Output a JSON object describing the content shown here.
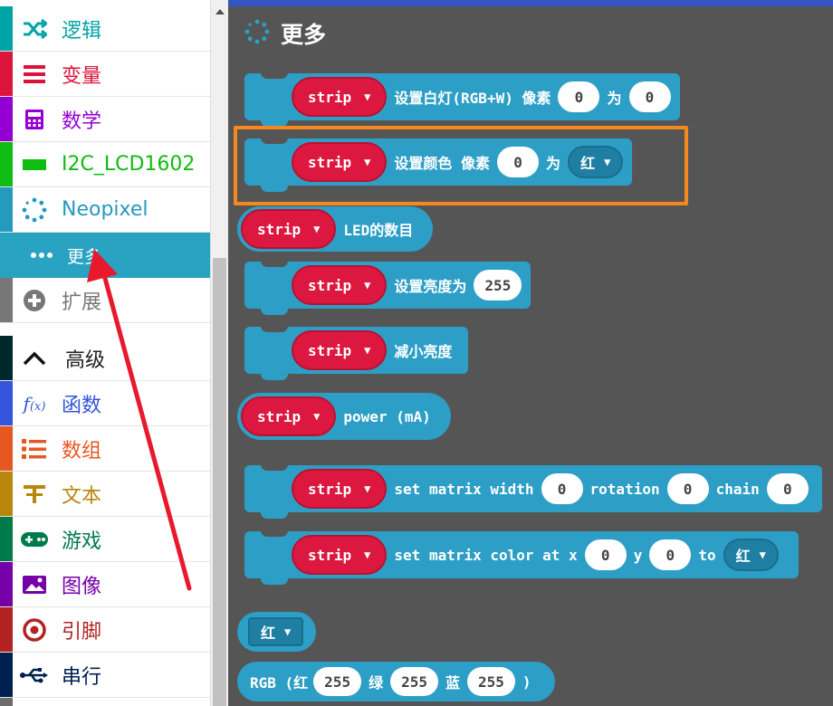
{
  "sidebar": {
    "items": [
      {
        "label": "逻辑",
        "icon": "shuffle-icon",
        "color": "#00a4a6"
      },
      {
        "label": "变量",
        "icon": "list-lines-icon",
        "color": "#dc143c"
      },
      {
        "label": "数学",
        "icon": "calculator-icon",
        "color": "#9400d3"
      },
      {
        "label": "I2C_LCD1602",
        "icon": "rectangle-icon",
        "color": "#0fbc11"
      },
      {
        "label": "Neopixel",
        "icon": "dotted-circle-icon",
        "color": "#2699bf"
      },
      {
        "label": "更多",
        "icon": "ellipsis-icon",
        "color": "#2699bf"
      },
      {
        "label": "扩展",
        "icon": "plus-circle-icon",
        "color": "#777777"
      },
      {
        "label": "高级",
        "icon": "chevron-up-icon",
        "color": "#00272b"
      },
      {
        "label": "函数",
        "icon": "function-icon",
        "color": "#3455db"
      },
      {
        "label": "数组",
        "icon": "numbered-list-icon",
        "color": "#e65722"
      },
      {
        "label": "文本",
        "icon": "text-icon",
        "color": "#b8860b"
      },
      {
        "label": "游戏",
        "icon": "gamepad-icon",
        "color": "#007a4b"
      },
      {
        "label": "图像",
        "icon": "image-icon",
        "color": "#7600a8"
      },
      {
        "label": "引脚",
        "icon": "target-icon",
        "color": "#b22222"
      },
      {
        "label": "串行",
        "icon": "usb-icon",
        "color": "#002050"
      }
    ]
  },
  "workspace": {
    "title": "更多",
    "blocks": {
      "b1": {
        "var": "strip",
        "t1": "设置白灯(RGB+W) 像素",
        "v1": "0",
        "t2": "为",
        "v2": "0"
      },
      "b2": {
        "var": "strip",
        "t1": "设置颜色 像素",
        "v1": "0",
        "t2": "为",
        "color": "红"
      },
      "b3": {
        "var": "strip",
        "t1": "LED的数目"
      },
      "b4": {
        "var": "strip",
        "t1": "设置亮度为",
        "v1": "255"
      },
      "b5": {
        "var": "strip",
        "t1": "减小亮度"
      },
      "b6": {
        "var": "strip",
        "t1": "power (mA)"
      },
      "b7": {
        "var": "strip",
        "t1": "set matrix width",
        "v1": "0",
        "t2": "rotation",
        "v2": "0",
        "t3": "chain",
        "v3": "0"
      },
      "b8": {
        "var": "strip",
        "t1": "set matrix color at x",
        "v1": "0",
        "t2": "y",
        "v2": "0",
        "t3": "to",
        "color": "红"
      },
      "b9": {
        "color": "红"
      },
      "b10": {
        "t1": "RGB (红",
        "v1": "255",
        "t2": "绿",
        "v2": "255",
        "t3": "蓝",
        "v3": "255",
        "t4": ")"
      }
    }
  }
}
